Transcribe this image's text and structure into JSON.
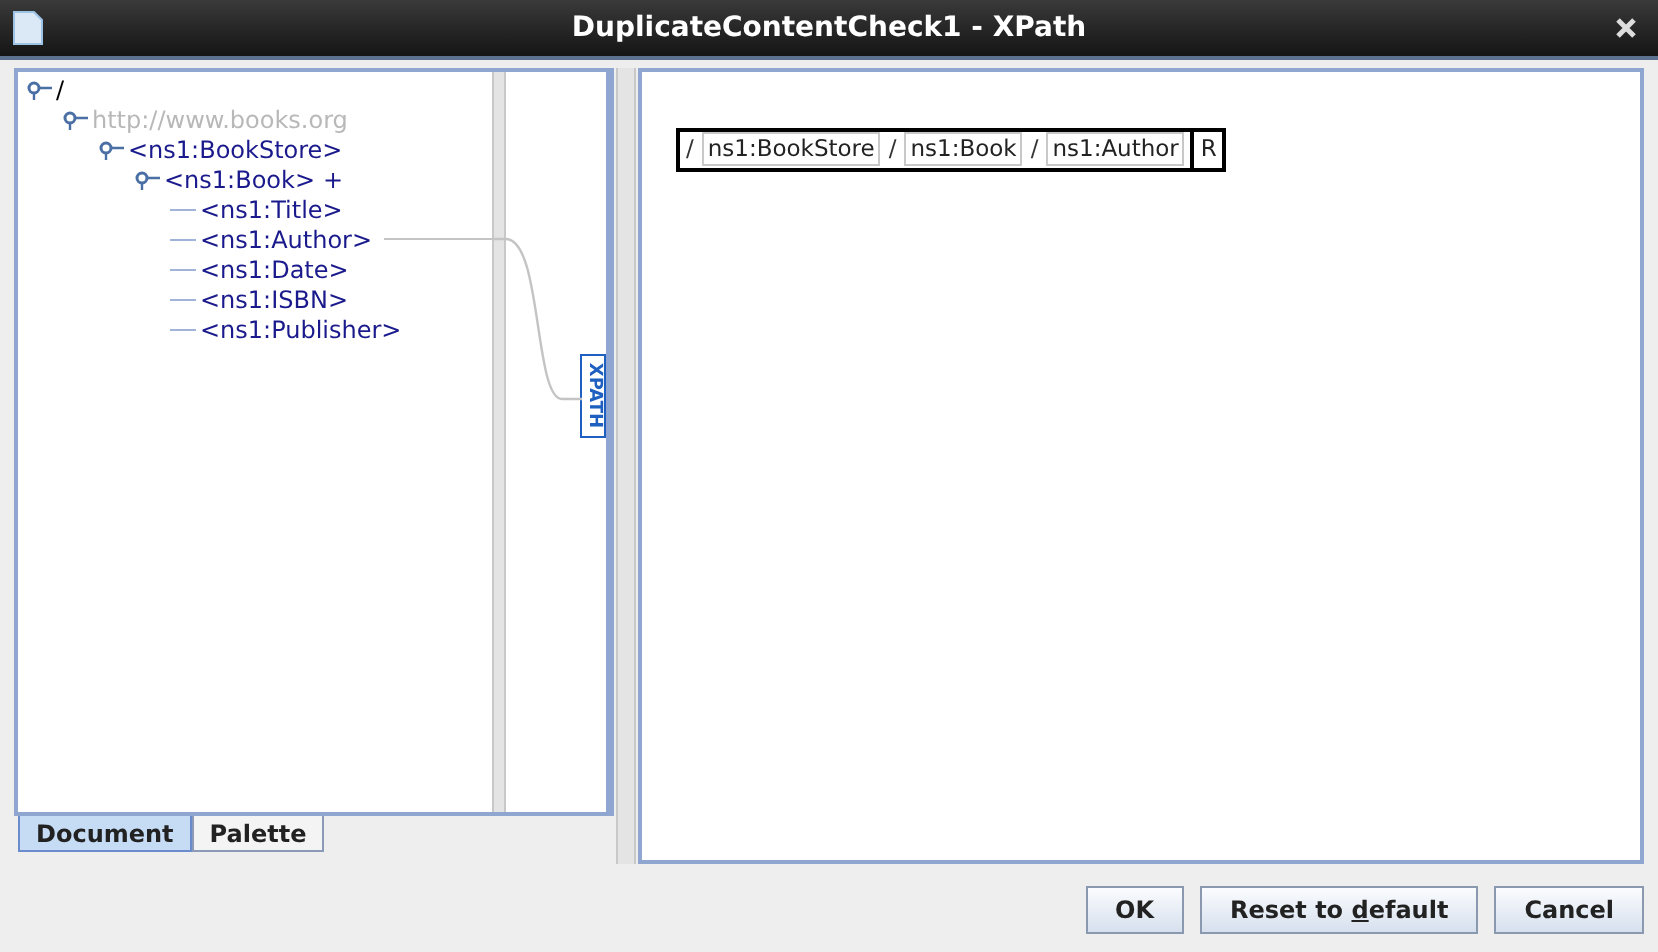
{
  "window": {
    "title": "DuplicateContentCheck1 - XPath"
  },
  "tree": [
    {
      "label": "/",
      "kind": "root",
      "children": [
        {
          "label": "http://www.books.org",
          "kind": "namespace",
          "children": [
            {
              "label": "<ns1:BookStore>",
              "kind": "element",
              "children": [
                {
                  "label": "<ns1:Book>",
                  "suffix": "+",
                  "kind": "element",
                  "children": [
                    {
                      "label": "<ns1:Title>",
                      "kind": "element",
                      "linked": false
                    },
                    {
                      "label": "<ns1:Author>",
                      "kind": "element",
                      "linked": true
                    },
                    {
                      "label": "<ns1:Date>",
                      "kind": "element",
                      "linked": false
                    },
                    {
                      "label": "<ns1:ISBN>",
                      "kind": "element",
                      "linked": false
                    },
                    {
                      "label": "<ns1:Publisher>",
                      "kind": "element",
                      "linked": false
                    }
                  ]
                }
              ]
            }
          ]
        }
      ]
    }
  ],
  "xpath_label": "XPATH",
  "tabs": [
    {
      "label": "Document",
      "selected": true
    },
    {
      "label": "Palette",
      "selected": false
    }
  ],
  "breadcrumb": {
    "steps": [
      "ns1:BookStore",
      "ns1:Book",
      "ns1:Author"
    ],
    "separator": "/",
    "end": "R"
  },
  "buttons": [
    {
      "label": "OK"
    },
    {
      "label_before": "Reset to ",
      "mnemonic": "d",
      "label_after": "efault"
    },
    {
      "label": "Cancel"
    }
  ]
}
